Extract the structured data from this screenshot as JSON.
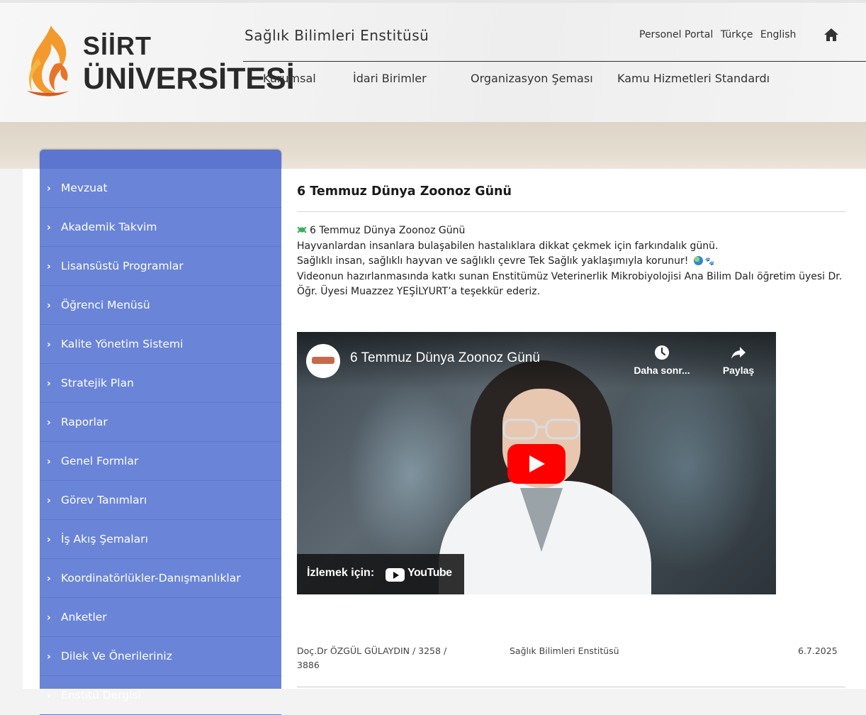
{
  "header": {
    "logo_line1": "SİİRT",
    "logo_line2": "ÜNİVERSİTESİ",
    "site_title": "Sağlık Bilimleri Enstitüsü",
    "top_links": [
      "Personel Portal",
      "Türkçe",
      "English"
    ],
    "home_icon": "home-icon",
    "nav": [
      "Kurumsal",
      "İdari Birimler",
      "Organizasyon Şeması",
      "Kamu Hizmetleri Standardı"
    ]
  },
  "sidebar": {
    "items": [
      "Mevzuat",
      "Akademik Takvim",
      "Lisansüstü Programlar",
      "Öğrenci Menüsü",
      "Kalite Yönetim Sistemi",
      "Stratejik Plan",
      "Raporlar",
      "Genel Formlar",
      "Görev Tanımları",
      "İş Akış Şemaları",
      "Koordinatörlükler-Danışmanlıklar",
      "Anketler",
      "Dilek Ve Önerileriniz",
      "Enstitü Dergisi"
    ],
    "chevron": "›"
  },
  "article": {
    "title": "6 Temmuz Dünya Zoonoz Günü",
    "line1": "6 Temmuz Dünya Zoonoz Günü",
    "line2": "Hayvanlardan insanlara bulaşabilen hastalıklara dikkat çekmek için farkındalık günü.",
    "line3": "Sağlıklı insan, sağlıklı hayvan ve sağlıklı çevre Tek Sağlık yaklaşımıyla korunur!",
    "line4": "Videonun hazırlanmasında katkı sunan Enstitümüz Veterinerlik Mikrobiyolojisi Ana Bilim Dalı öğretim üyesi Dr. Öğr. Üyesi Muazzez YEŞİLYURT’a teşekkür ederiz.",
    "paws": "🐾"
  },
  "video": {
    "title": "6 Temmuz Dünya Zoonoz Günü",
    "watch_later": "Daha sonr...",
    "share": "Paylaş",
    "watch_on": "İzlemek için:",
    "youtube": "YouTube",
    "accent": "#ff0000"
  },
  "meta": {
    "author": "Doç.Dr ÖZGÜL GÜLAYDIN / 3258 / 3886",
    "unit": "Sağlık Bilimleri Enstitüsü",
    "date": "6.7.2025"
  },
  "colors": {
    "sidebar": "#6a84d8",
    "band": "#e2d9cc"
  }
}
